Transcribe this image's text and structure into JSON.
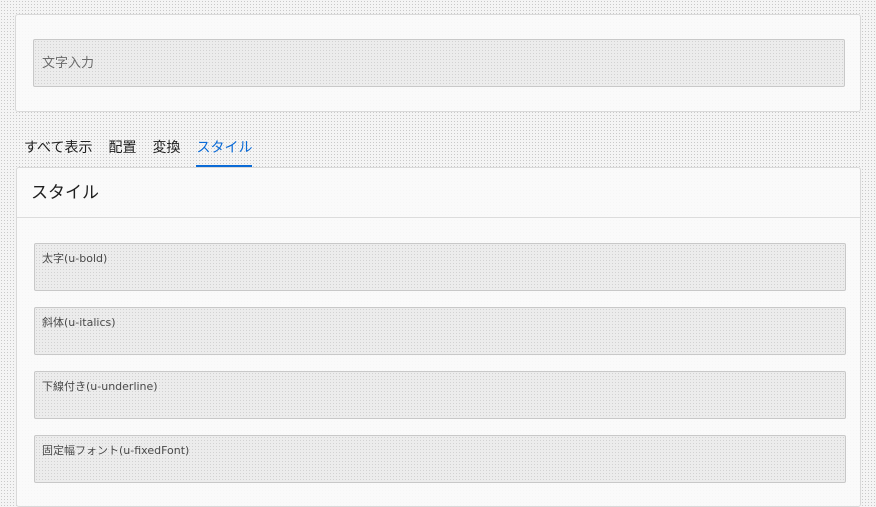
{
  "top": {
    "input_placeholder": "文字入力"
  },
  "tabs": [
    {
      "label": "すべて表示"
    },
    {
      "label": "配置"
    },
    {
      "label": "変換"
    },
    {
      "label": "スタイル",
      "active": true
    }
  ],
  "main": {
    "title": "スタイル",
    "fields": [
      {
        "label": "太字(u-bold)"
      },
      {
        "label": "斜体(u-italics)"
      },
      {
        "label": "下線付き(u-underline)"
      },
      {
        "label": "固定幅フォント(u-fixedFont)"
      }
    ]
  },
  "colors": {
    "accent": "#0a6ad6",
    "text": "#1f1f1f",
    "border": "#c8c8c8"
  }
}
